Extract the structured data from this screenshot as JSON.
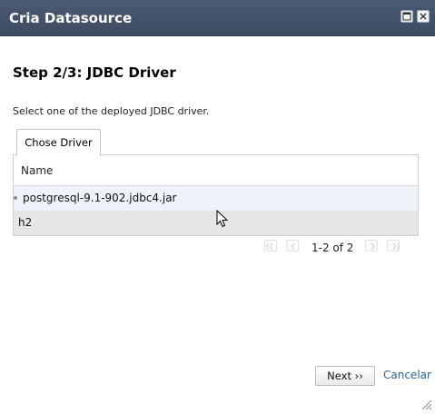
{
  "window": {
    "title": "Cria Datasource",
    "maximize_icon": "maximize-icon",
    "close_icon": "close-icon"
  },
  "step": {
    "title": "Step 2/3: JDBC Driver",
    "instructions": "Select one of the deployed JDBC driver."
  },
  "tabs": [
    {
      "label": "Chose Driver",
      "active": true
    }
  ],
  "grid": {
    "columns": [
      "Name"
    ],
    "rows": [
      {
        "name": "postgresql-9.1-902.jdbc4.jar",
        "selected": true
      },
      {
        "name": "h2",
        "selected": false
      }
    ]
  },
  "pager": {
    "text": "1-2 of 2",
    "icons": [
      "first-page-icon",
      "prev-page-icon",
      "next-page-icon",
      "last-page-icon"
    ]
  },
  "footer": {
    "next_label": "Next ››",
    "cancel_label": "Cancelar"
  },
  "colors": {
    "titlebar": "#3d4c62",
    "selected_row": "#eef3f9",
    "alt_row": "#e6e6e6",
    "link": "#2a6496"
  }
}
